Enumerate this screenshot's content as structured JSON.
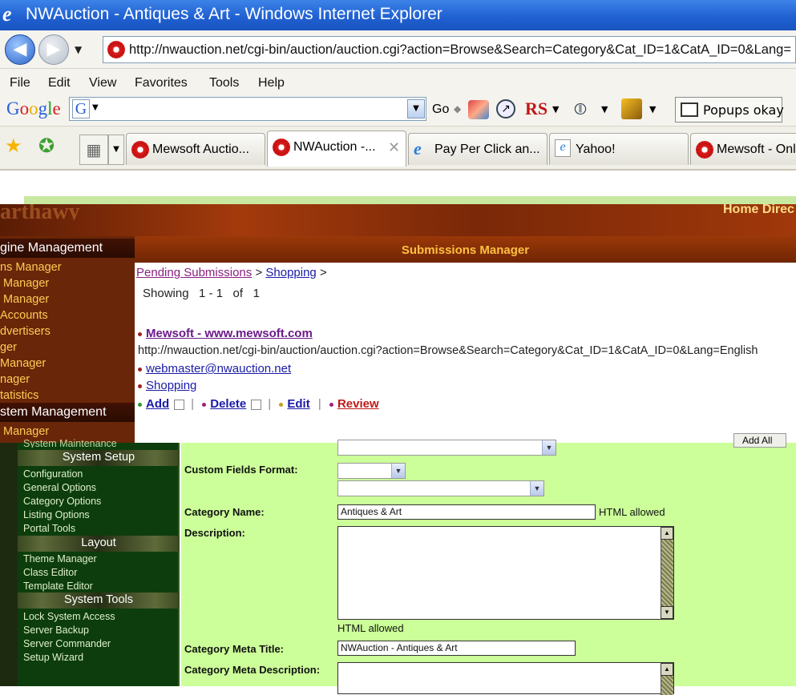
{
  "window": {
    "title": "NWAuction - Antiques & Art - Windows Internet Explorer"
  },
  "address": {
    "url": "http://nwauction.net/cgi-bin/auction/auction.cgi?action=Browse&Search=Category&Cat_ID=1&CatA_ID=0&Lang="
  },
  "menu": [
    "File",
    "Edit",
    "View",
    "Favorites",
    "Tools",
    "Help"
  ],
  "google_bar": {
    "logo": "Google",
    "go": "Go",
    "rs": "RS",
    "popups": "Popups okay"
  },
  "tabs": [
    {
      "label": "Mewsoft Auctio..."
    },
    {
      "label": "NWAuction -..."
    },
    {
      "label": "Pay Per Click an..."
    },
    {
      "label": "Yahoo!"
    },
    {
      "label": "Mewsoft - Onl"
    }
  ],
  "topnav": "Home  Direc",
  "upper_sidebar": {
    "heading1": "gine Management",
    "items1": [
      "ns Manager",
      "Manager",
      "Manager",
      "Accounts",
      "dvertisers",
      "ger",
      "Manager",
      "nager",
      "tatistics"
    ],
    "heading2": "stem Management",
    "items2": [
      "Manager"
    ]
  },
  "submissions": {
    "header": "Submissions Manager",
    "breadcrumb_pending": "Pending Submissions",
    "breadcrumb_sep": ">",
    "breadcrumb_shopping": "Shopping",
    "breadcrumb_tail": ">",
    "showing": "Showing   1 - 1   of   1",
    "site_title": "Mewsoft - www.mewsoft.com",
    "site_url": "http://nwauction.net/cgi-bin/auction/auction.cgi?action=Browse&Search=Category&Cat_ID=1&CatA_ID=0&Lang=English",
    "email": "webmaster@nwauction.net",
    "category": "Shopping",
    "actions": {
      "add": "Add",
      "delete": "Delete",
      "edit": "Edit",
      "review": "Review",
      "separator": "|"
    },
    "add_all": "Add All"
  },
  "lower_sidebar": {
    "cut_item": "System Maintenance",
    "sections": [
      {
        "title": "System Setup",
        "items": [
          "Configuration",
          "General Options",
          "Category Options",
          "Listing Options",
          "Portal Tools"
        ]
      },
      {
        "title": "Layout",
        "items": [
          "Theme Manager",
          "Class Editor",
          "Template Editor"
        ]
      },
      {
        "title": "System Tools",
        "items": [
          "Lock System Access",
          "Server Backup",
          "Server Commander",
          "Setup Wizard"
        ]
      }
    ]
  },
  "form": {
    "custom_fields_label": "Custom Fields Format:",
    "category_name_label": "Category Name:",
    "category_name_value": "Antiques & Art",
    "html_allowed": "HTML allowed",
    "description_label": "Description:",
    "html_allowed_below": "HTML allowed",
    "meta_title_label": "Category Meta Title:",
    "meta_title_value": "NWAuction - Antiques & Art",
    "meta_desc_label": "Category Meta Description:"
  },
  "colors": {
    "titlebar": "#1f5fd0",
    "banner": "#7a2808",
    "form_bg": "#ccff99",
    "sidebar_green": "#0d3d0d",
    "link": "#1a1aa8"
  }
}
